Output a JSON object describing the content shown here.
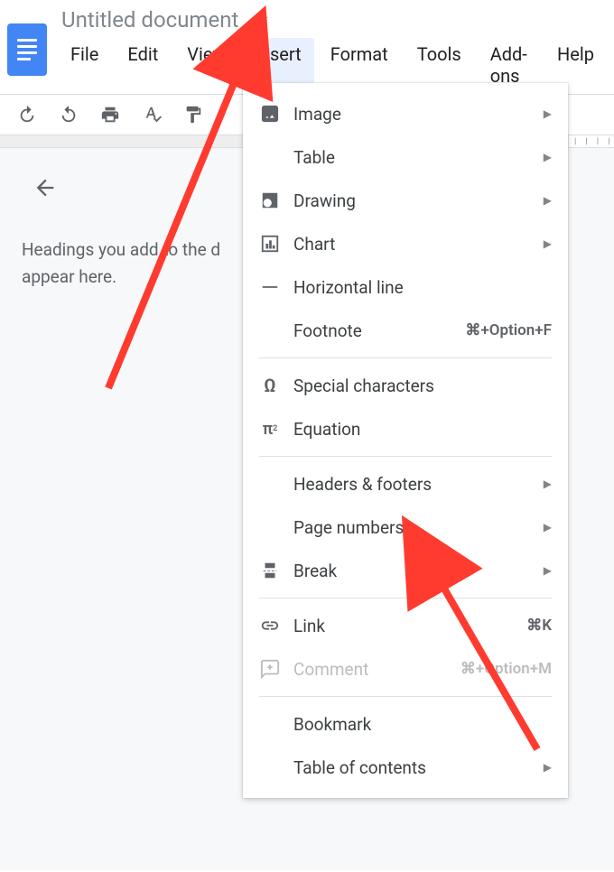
{
  "header": {
    "title": "Untitled document"
  },
  "menubar": {
    "items": [
      "File",
      "Edit",
      "View",
      "Insert",
      "Format",
      "Tools",
      "Add-ons",
      "Help"
    ],
    "active": "Insert"
  },
  "outline": {
    "placeholder_line1": "Headings you add to the d",
    "placeholder_line2": "appear here."
  },
  "ruler": {
    "ticks": "| | | |"
  },
  "insert_menu": {
    "image": {
      "label": "Image"
    },
    "table": {
      "label": "Table"
    },
    "drawing": {
      "label": "Drawing"
    },
    "chart": {
      "label": "Chart"
    },
    "hline": {
      "label": "Horizontal line"
    },
    "footnote": {
      "label": "Footnote",
      "shortcut": "⌘+Option+F"
    },
    "special": {
      "label": "Special characters"
    },
    "equation": {
      "label": "Equation"
    },
    "headers": {
      "label": "Headers & footers"
    },
    "pagenum": {
      "label": "Page numbers"
    },
    "break": {
      "label": "Break"
    },
    "link": {
      "label": "Link",
      "shortcut": "⌘K"
    },
    "comment": {
      "label": "Comment",
      "shortcut": "⌘+Option+M"
    },
    "bookmark": {
      "label": "Bookmark"
    },
    "toc": {
      "label": "Table of contents"
    }
  }
}
